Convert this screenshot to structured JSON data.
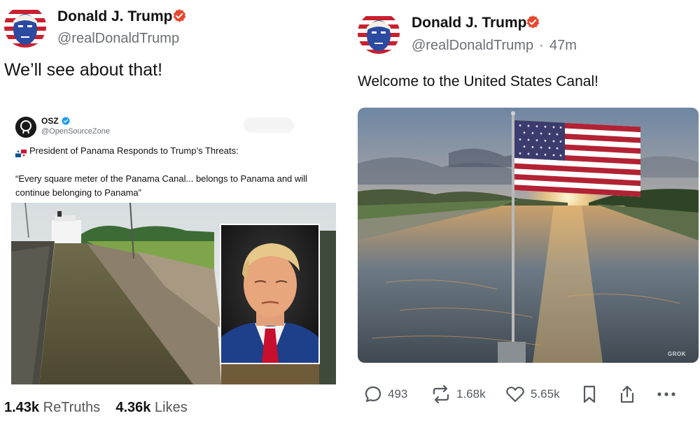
{
  "left_post": {
    "author": {
      "name": "Donald J. Trump",
      "handle": "@realDonaldTrump"
    },
    "text": "We’ll see about that!",
    "embedded_post": {
      "author": {
        "name": "OSZ",
        "handle": "@OpenSourceZone"
      },
      "headline": "President of Panama Responds to Trump’s Threats:",
      "quote": "“Every square meter of the Panama Canal... belongs to Panama and will continue belonging to Panama”"
    },
    "stats": {
      "retruths_count": "1.43k",
      "retruths_label": "ReTruths",
      "likes_count": "4.36k",
      "likes_label": "Likes"
    }
  },
  "right_post": {
    "author": {
      "name": "Donald J. Trump",
      "handle": "@realDonaldTrump"
    },
    "separator": "·",
    "time": "47m",
    "text": "Welcome to the United States Canal!",
    "image_watermark": "GROK",
    "actions": {
      "replies": "493",
      "retruths": "1.68k",
      "likes": "5.65k"
    }
  },
  "colors": {
    "verified": "#e8462e",
    "text": "#111111",
    "muted": "#6b6f75",
    "icon": "#555a60"
  },
  "icons": [
    "verified-badge-icon",
    "reply-icon",
    "retruth-icon",
    "like-icon",
    "bookmark-icon",
    "share-icon",
    "more-icon"
  ]
}
